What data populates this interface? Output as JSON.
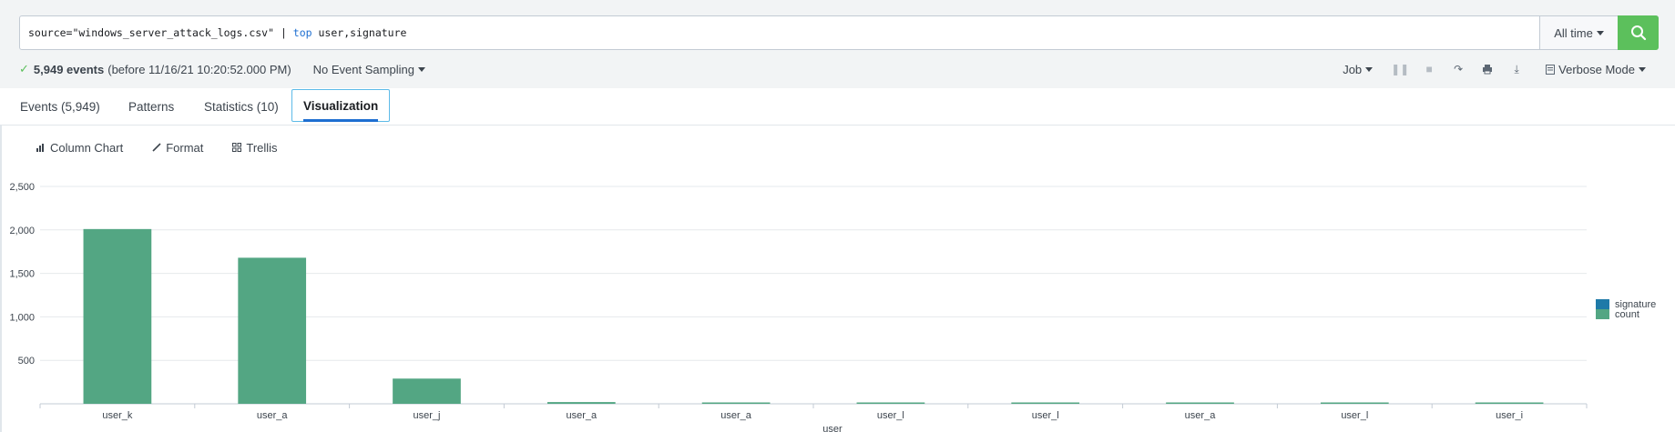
{
  "search": {
    "query_prefix": "source=\"windows_server_attack_logs.csv\" | ",
    "query_keyword": "top",
    "query_suffix": " user,signature",
    "time_range": "All time",
    "search_button_icon": "magnifier-icon"
  },
  "status": {
    "event_count": "5,949 events",
    "event_time": "(before 11/16/21 10:20:52.000 PM)",
    "sampling": "No Event Sampling",
    "job": "Job",
    "mode": "Verbose Mode"
  },
  "tabs": [
    {
      "label": "Events (5,949)"
    },
    {
      "label": "Patterns"
    },
    {
      "label": "Statistics (10)"
    },
    {
      "label": "Visualization"
    }
  ],
  "viz_toolbar": {
    "chart_type": "Column Chart",
    "format": "Format",
    "trellis": "Trellis"
  },
  "colors": {
    "signature": "#1e7aa8",
    "count": "#53a683",
    "accent": "#5cc05c"
  },
  "chart_data": {
    "type": "bar",
    "categories": [
      "user_k",
      "user_a",
      "user_j",
      "user_a",
      "user_a",
      "user_l",
      "user_l",
      "user_a",
      "user_l",
      "user_i"
    ],
    "series": [
      {
        "name": "signature",
        "values": [
          0,
          0,
          0,
          0,
          0,
          0,
          0,
          0,
          0,
          0
        ]
      },
      {
        "name": "count",
        "values": [
          2010,
          1680,
          290,
          20,
          12,
          10,
          10,
          10,
          10,
          10
        ]
      }
    ],
    "xlabel": "user",
    "ylabel": "",
    "ylim": [
      0,
      2500
    ],
    "yticks": [
      "500",
      "1,000",
      "1,500",
      "2,000",
      "2,500"
    ],
    "ytick_values": [
      500,
      1000,
      1500,
      2000,
      2500
    ],
    "grid": true,
    "legend_position": "right"
  }
}
